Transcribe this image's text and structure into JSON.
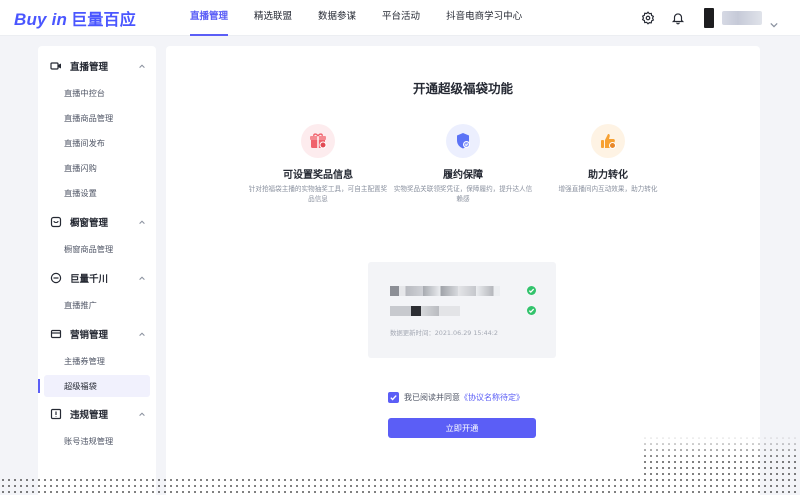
{
  "app": {
    "logo_text": "Buy in",
    "logo_cn": "巨量百应",
    "brand_color": "#4a56ff",
    "accent_color": "#5b5ef6"
  },
  "nav": {
    "items": [
      {
        "label": "直播管理",
        "active": true
      },
      {
        "label": "精选联盟",
        "active": false
      },
      {
        "label": "数据参谋",
        "active": false
      },
      {
        "label": "平台活动",
        "active": false
      },
      {
        "label": "抖音电商学习中心",
        "active": false
      }
    ]
  },
  "header_icons": [
    "settings-icon",
    "bell-icon"
  ],
  "sidebar": {
    "groups": [
      {
        "label": "直播管理",
        "icon": "live-icon",
        "items": [
          "直播中控台",
          "直播商品管理",
          "直播间发布",
          "直播闪购",
          "直播设置"
        ]
      },
      {
        "label": "橱窗管理",
        "icon": "window-icon",
        "items": [
          "橱窗商品管理"
        ]
      },
      {
        "label": "巨量千川",
        "icon": "qianchuan-icon",
        "items": [
          "直播推广"
        ]
      },
      {
        "label": "营销管理",
        "icon": "marketing-icon",
        "items": [
          "主播券管理",
          "超级福袋"
        ]
      },
      {
        "label": "违规管理",
        "icon": "violation-icon",
        "items": [
          "账号违规管理"
        ]
      }
    ],
    "active_item": "超级福袋"
  },
  "main": {
    "title": "开通超级福袋功能",
    "features": [
      {
        "title": "可设置奖品信息",
        "desc": "针对抢福袋主播的实物抽奖工具，可自主配置奖品信息",
        "icon": "gift-icon",
        "color": "#f0616b",
        "bg": "#fdecee"
      },
      {
        "title": "履约保障",
        "desc": "实物奖品关联领奖凭证，保障履约，提升达人信赖感",
        "icon": "shield-icon",
        "color": "#5b73f6",
        "bg": "#eceffe"
      },
      {
        "title": "助力转化",
        "desc": "增强直播间内互动效果，助力转化",
        "icon": "thumbs-up-icon",
        "color": "#f7a132",
        "bg": "#fef3e4"
      }
    ],
    "update_time": "数据更新时间：2021.06.29 15:44:2",
    "agreement_prefix": "我已阅读并同意",
    "agreement_link": "《协议名称待定》",
    "agreement_checked": true,
    "submit_label": "立即开通"
  }
}
